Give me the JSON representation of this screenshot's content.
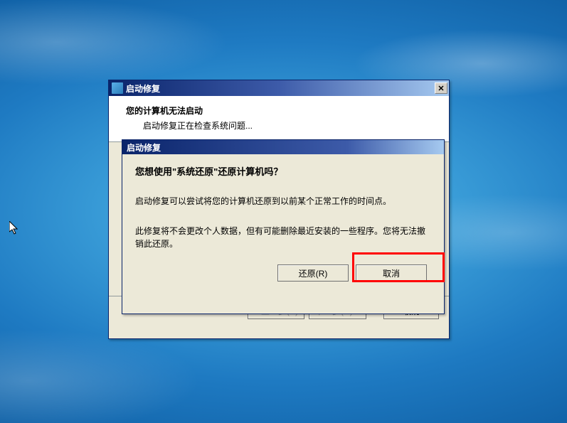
{
  "main_window": {
    "title": "启动修复",
    "header_title": "您的计算机无法启动",
    "header_sub": "启动修复正在检查系统问题...",
    "buttons": {
      "back": "< 上一步(B)",
      "next": "下一步(N) >",
      "cancel": "取消"
    }
  },
  "inner_dialog": {
    "title": "启动修复",
    "question": "您想使用\"系统还原\"还原计算机吗？",
    "paragraph1": "启动修复可以尝试将您的计算机还原到以前某个正常工作的时间点。",
    "paragraph2": "此修复将不会更改个人数据，但有可能删除最近安装的一些程序。您将无法撤销此还原。",
    "buttons": {
      "restore": "还原(R)",
      "cancel": "取消"
    }
  },
  "icons": {
    "close": "✕"
  }
}
